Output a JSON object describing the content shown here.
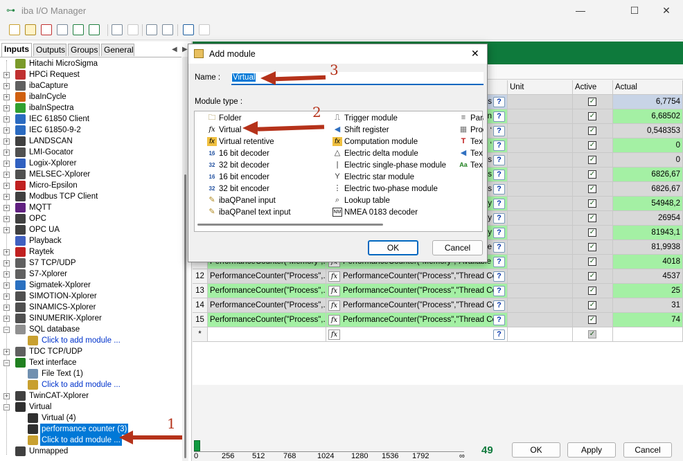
{
  "window": {
    "title": "iba I/O Manager",
    "minimize": "—",
    "maximize": "☐",
    "close": "✕"
  },
  "tabs": [
    "Inputs",
    "Outputs",
    "Groups",
    "General"
  ],
  "tree": [
    {
      "label": "Hitachi MicroSigma",
      "expander": "",
      "depth": 0,
      "color": "#7a9a2a",
      "link": false,
      "selected": false
    },
    {
      "label": "HPCi Request",
      "expander": "+",
      "depth": 0,
      "color": "#c03030",
      "link": false,
      "selected": false
    },
    {
      "label": "ibaCapture",
      "expander": "+",
      "depth": 0,
      "color": "#606060",
      "link": false,
      "selected": false
    },
    {
      "label": "ibaInCycle",
      "expander": "+",
      "depth": 0,
      "color": "#d06010",
      "link": false,
      "selected": false
    },
    {
      "label": "ibaInSpectra",
      "expander": "+",
      "depth": 0,
      "color": "#30a030",
      "link": false,
      "selected": false
    },
    {
      "label": "IEC 61850 Client",
      "expander": "+",
      "depth": 0,
      "color": "#2a6ac0",
      "link": false,
      "selected": false
    },
    {
      "label": "IEC 61850-9-2",
      "expander": "+",
      "depth": 0,
      "color": "#2a6ac0",
      "link": false,
      "selected": false
    },
    {
      "label": "LANDSCAN",
      "expander": "+",
      "depth": 0,
      "color": "#404040",
      "link": false,
      "selected": false
    },
    {
      "label": "LMI-Gocator",
      "expander": "+",
      "depth": 0,
      "color": "#505050",
      "link": false,
      "selected": false
    },
    {
      "label": "Logix-Xplorer",
      "expander": "+",
      "depth": 0,
      "color": "#3060c0",
      "link": false,
      "selected": false
    },
    {
      "label": "MELSEC-Xplorer",
      "expander": "+",
      "depth": 0,
      "color": "#505050",
      "link": false,
      "selected": false
    },
    {
      "label": "Micro-Epsilon",
      "expander": "+",
      "depth": 0,
      "color": "#c02020",
      "link": false,
      "selected": false
    },
    {
      "label": "Modbus TCP Client",
      "expander": "+",
      "depth": 0,
      "color": "#404040",
      "link": false,
      "selected": false
    },
    {
      "label": "MQTT",
      "expander": "+",
      "depth": 0,
      "color": "#602080",
      "link": false,
      "selected": false
    },
    {
      "label": "OPC",
      "expander": "+",
      "depth": 0,
      "color": "#404040",
      "link": false,
      "selected": false
    },
    {
      "label": "OPC UA",
      "expander": "+",
      "depth": 0,
      "color": "#404040",
      "link": false,
      "selected": false
    },
    {
      "label": "Playback",
      "expander": "",
      "depth": 0,
      "color": "#4060c0",
      "link": false,
      "selected": false
    },
    {
      "label": "Raytek",
      "expander": "+",
      "depth": 0,
      "color": "#c02020",
      "link": false,
      "selected": false
    },
    {
      "label": "S7 TCP/UDP",
      "expander": "+",
      "depth": 0,
      "color": "#606060",
      "link": false,
      "selected": false
    },
    {
      "label": "S7-Xplorer",
      "expander": "+",
      "depth": 0,
      "color": "#606060",
      "link": false,
      "selected": false
    },
    {
      "label": "Sigmatek-Xplorer",
      "expander": "+",
      "depth": 0,
      "color": "#2a70c0",
      "link": false,
      "selected": false
    },
    {
      "label": "SIMOTION-Xplorer",
      "expander": "+",
      "depth": 0,
      "color": "#505050",
      "link": false,
      "selected": false
    },
    {
      "label": "SINAMICS-Xplorer",
      "expander": "+",
      "depth": 0,
      "color": "#505050",
      "link": false,
      "selected": false
    },
    {
      "label": "SINUMERIK-Xplorer",
      "expander": "+",
      "depth": 0,
      "color": "#505050",
      "link": false,
      "selected": false
    },
    {
      "label": "SQL database",
      "expander": "−",
      "depth": 0,
      "color": "#909090",
      "link": false,
      "selected": false
    },
    {
      "label": "Click to add module ...",
      "expander": "",
      "depth": 1,
      "color": "#c8a030",
      "link": true,
      "selected": false
    },
    {
      "label": "TDC TCP/UDP",
      "expander": "+",
      "depth": 0,
      "color": "#606060",
      "link": false,
      "selected": false
    },
    {
      "label": "Text interface",
      "expander": "−",
      "depth": 0,
      "color": "#208020",
      "link": false,
      "selected": false
    },
    {
      "label": "File Text (1)",
      "expander": "",
      "depth": 1,
      "color": "#7090b0",
      "link": false,
      "selected": false
    },
    {
      "label": "Click to add module ...",
      "expander": "",
      "depth": 1,
      "color": "#c8a030",
      "link": true,
      "selected": false
    },
    {
      "label": "TwinCAT-Xplorer",
      "expander": "+",
      "depth": 0,
      "color": "#404040",
      "link": false,
      "selected": false
    },
    {
      "label": "Virtual",
      "expander": "−",
      "depth": 0,
      "color": "#303030",
      "link": false,
      "selected": false
    },
    {
      "label": "Virtual (4)",
      "expander": "",
      "depth": 1,
      "color": "#303030",
      "link": false,
      "selected": false
    },
    {
      "label": "performance counter (3)",
      "expander": "",
      "depth": 1,
      "color": "#303030",
      "link": false,
      "selected": true
    },
    {
      "label": "Click to add module ...",
      "expander": "",
      "depth": 1,
      "color": "#c8a030",
      "link": false,
      "selected": true
    },
    {
      "label": "Unmapped",
      "expander": "",
      "depth": 0,
      "color": "#404040",
      "link": false,
      "selected": false
    }
  ],
  "grid": {
    "headers": {
      "unit": "Unit",
      "active": "Active",
      "actual": "Actual"
    },
    "rows": [
      {
        "num": "",
        "name": "",
        "expr": "",
        "expr_tail": "ss",
        "actual": "6,7754",
        "color": "#c8d4e6"
      },
      {
        "num": "",
        "name": "",
        "expr": "",
        "expr_tail": "on",
        "actual": "6,68502",
        "color": "#a4f0a4"
      },
      {
        "num": "",
        "name": "",
        "expr": "",
        "expr_tail": "‘",
        "actual": "0,548353",
        "color": "#d8d8d8"
      },
      {
        "num": "",
        "name": "",
        "expr": "",
        "expr_tail": "‘",
        "actual": "0",
        "color": "#a4f0a4"
      },
      {
        "num": "",
        "name": "",
        "expr": "",
        "expr_tail": "Dis",
        "actual": "0",
        "color": "#d8d8d8"
      },
      {
        "num": "",
        "name": "",
        "expr": "",
        "expr_tail": "Dis",
        "actual": "6826,67",
        "color": "#a4f0a4"
      },
      {
        "num": "",
        "name": "",
        "expr": "",
        "expr_tail": "Dis",
        "actual": "6826,67",
        "color": "#d8d8d8"
      },
      {
        "num": "",
        "name": "",
        "expr": "",
        "expr_tail": "y",
        "actual": "54948,2",
        "color": "#a4f0a4"
      },
      {
        "num": "",
        "name": "",
        "expr": "",
        "expr_tail": "y",
        "actual": "26954",
        "color": "#d8d8d8"
      },
      {
        "num": "",
        "name": "",
        "expr": "",
        "expr_tail": "y",
        "actual": "81943,1",
        "color": "#a4f0a4"
      },
      {
        "num": "",
        "name": "",
        "expr": "",
        "expr_tail": "te",
        "actual": "81,9938",
        "color": "#d8d8d8"
      },
      {
        "num": "",
        "name": "PerformanceCounter(\"Memory\",...",
        "expr": "PerformanceCounter(\"Memory\",\"Available MB",
        "expr_tail": "",
        "actual": "4018",
        "color": "#a4f0a4"
      },
      {
        "num": "12",
        "name": "PerformanceCounter(\"Process\",...",
        "expr": "PerformanceCounter(\"Process\",\"Thread Coun",
        "expr_tail": "",
        "actual": "4537",
        "color": "#d8d8d8"
      },
      {
        "num": "13",
        "name": "PerformanceCounter(\"Process\",...",
        "expr": "PerformanceCounter(\"Process\",\"Thread Coun",
        "expr_tail": "",
        "actual": "25",
        "color": "#a4f0a4"
      },
      {
        "num": "14",
        "name": "PerformanceCounter(\"Process\",...",
        "expr": "PerformanceCounter(\"Process\",\"Thread Coun",
        "expr_tail": "",
        "actual": "31",
        "color": "#d8d8d8"
      },
      {
        "num": "15",
        "name": "PerformanceCounter(\"Process\",...",
        "expr": "PerformanceCounter(\"Process\",\"Thread Coun",
        "expr_tail": "",
        "actual": "74",
        "color": "#a4f0a4"
      }
    ],
    "new_row_marker": "*"
  },
  "bottom": {
    "ticks": [
      "0",
      "256",
      "512",
      "768",
      "1024",
      "1280",
      "1536",
      "1792",
      "∞"
    ],
    "count": "49",
    "ok": "OK",
    "apply": "Apply",
    "cancel": "Cancel"
  },
  "dialog": {
    "title": "Add module",
    "close": "✕",
    "name_label": "Name :",
    "name_value": "Virtual",
    "type_label": "Module type :",
    "col1": [
      {
        "label": "Folder",
        "icon": "folder-icon",
        "glyph": "🗀"
      },
      {
        "label": "Virtual",
        "icon": "fx-icon",
        "glyph": "fx"
      },
      {
        "label": "Virtual retentive",
        "icon": "fx-retentive-icon",
        "glyph": "fx"
      },
      {
        "label": "16 bit decoder",
        "icon": "decoder-icon",
        "glyph": "1̲6"
      },
      {
        "label": "32 bit decoder",
        "icon": "decoder-icon",
        "glyph": "32"
      },
      {
        "label": "16 bit encoder",
        "icon": "encoder-icon",
        "glyph": "16"
      },
      {
        "label": "32 bit encoder",
        "icon": "encoder-icon",
        "glyph": "32"
      },
      {
        "label": "ibaQPanel input",
        "icon": "pencil-icon",
        "glyph": "✎"
      },
      {
        "label": "ibaQPanel text input",
        "icon": "pencil-icon",
        "glyph": "✎"
      }
    ],
    "col2": [
      {
        "label": "Trigger module",
        "icon": "trigger-icon",
        "glyph": "⎍"
      },
      {
        "label": "Shift register",
        "icon": "shift-icon",
        "glyph": "◀"
      },
      {
        "label": "Computation module",
        "icon": "computation-icon",
        "glyph": "fx"
      },
      {
        "label": "Electric delta module",
        "icon": "delta-icon",
        "glyph": "△"
      },
      {
        "label": "Electric single-phase module",
        "icon": "single-phase-icon",
        "glyph": "|"
      },
      {
        "label": "Electric star module",
        "icon": "star-icon",
        "glyph": "Y"
      },
      {
        "label": "Electric two-phase module",
        "icon": "two-phase-icon",
        "glyph": "⋮"
      },
      {
        "label": "Lookup table",
        "icon": "lookup-icon",
        "glyph": "⌕"
      },
      {
        "label": "NMEA 0183 decoder",
        "icon": "nmea-icon",
        "glyph": "NM"
      }
    ],
    "col3": [
      {
        "label": "Para",
        "icon": "param-icon",
        "glyph": "≡"
      },
      {
        "label": "Proc",
        "icon": "proc-icon",
        "glyph": "▦"
      },
      {
        "label": "Tex",
        "icon": "text-t-icon",
        "glyph": "T"
      },
      {
        "label": "Tex",
        "icon": "text-split-icon",
        "glyph": "◀"
      },
      {
        "label": "Tex",
        "icon": "text-aa-icon",
        "glyph": "Aa"
      }
    ],
    "ok": "OK",
    "cancel": "Cancel"
  },
  "callouts": [
    "1",
    "2",
    "3"
  ],
  "colors": {
    "accent_green": "#0e7a3c",
    "selection": "#0078d7",
    "arrow": "#b5321a"
  }
}
